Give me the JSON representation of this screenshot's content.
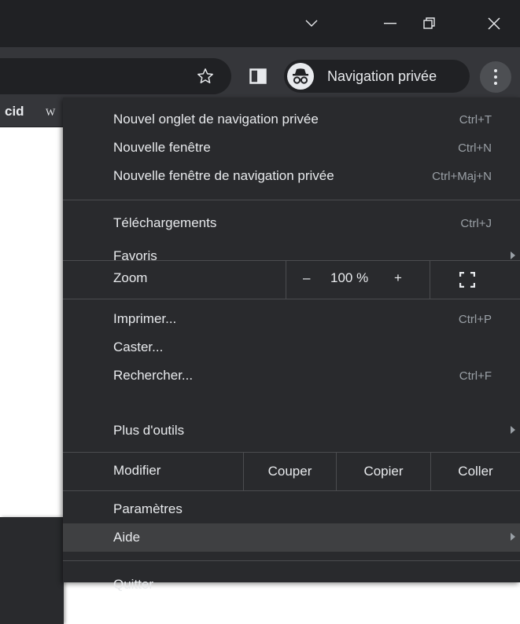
{
  "titlebar": {
    "dropdown_icon": "chevron-down-icon",
    "minimize_icon": "minimize-icon",
    "restore_icon": "restore-icon",
    "close_icon": "close-icon"
  },
  "toolbar": {
    "bookmark_icon": "star-icon",
    "side_panel_icon": "side-panel-icon",
    "incognito_label": "Navigation privée",
    "menu_icon": "kebab-menu-icon"
  },
  "bookmarks_bar": {
    "item_text": "cid",
    "item_favicon": "W"
  },
  "menu": {
    "items": [
      {
        "label": "Nouvel onglet de navigation privée",
        "shortcut": "Ctrl+T"
      },
      {
        "label": "Nouvelle fenêtre",
        "shortcut": "Ctrl+N"
      },
      {
        "label": "Nouvelle fenêtre de navigation privée",
        "shortcut": "Ctrl+Maj+N"
      },
      {
        "label": "Téléchargements",
        "shortcut": "Ctrl+J"
      },
      {
        "label": "Favoris",
        "shortcut": ""
      },
      {
        "label": "Imprimer...",
        "shortcut": "Ctrl+P"
      },
      {
        "label": "Caster...",
        "shortcut": ""
      },
      {
        "label": "Rechercher...",
        "shortcut": "Ctrl+F"
      },
      {
        "label": "Plus d'outils",
        "shortcut": ""
      },
      {
        "label": "Paramètres",
        "shortcut": ""
      },
      {
        "label": "Aide",
        "shortcut": ""
      },
      {
        "label": "Quitter",
        "shortcut": ""
      }
    ],
    "zoom": {
      "label": "Zoom",
      "minus": "–",
      "value": "100 %",
      "plus": "+"
    },
    "edit": {
      "label": "Modifier",
      "cut": "Couper",
      "copy": "Copier",
      "paste": "Coller"
    }
  },
  "colors": {
    "menu_bg": "#292a2d",
    "highlight": "#3f4042",
    "text": "#e8eaed"
  }
}
